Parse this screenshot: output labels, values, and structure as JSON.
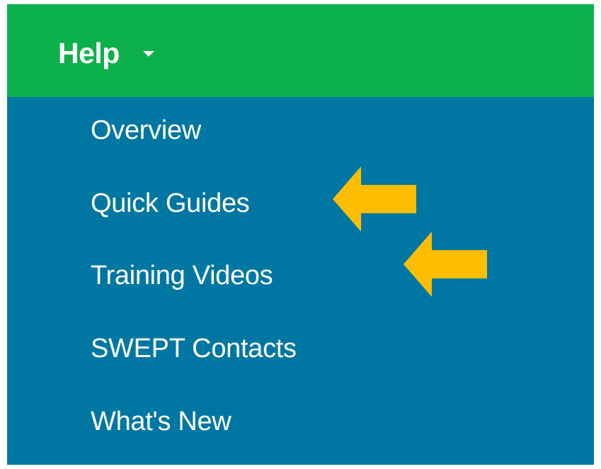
{
  "header": {
    "title": "Help",
    "caret_icon": "caret-down-icon",
    "background_color": "#0db14b"
  },
  "menu": {
    "background_color": "#0077a3",
    "items": [
      {
        "label": "Overview"
      },
      {
        "label": "Quick Guides"
      },
      {
        "label": "Training Videos"
      },
      {
        "label": "SWEPT Contacts"
      },
      {
        "label": "What's New"
      }
    ]
  },
  "annotations": {
    "arrow_icon": "arrow-left-icon",
    "arrow_color": "#ffbd00",
    "pointed_items": [
      "Quick Guides",
      "Training Videos"
    ]
  }
}
